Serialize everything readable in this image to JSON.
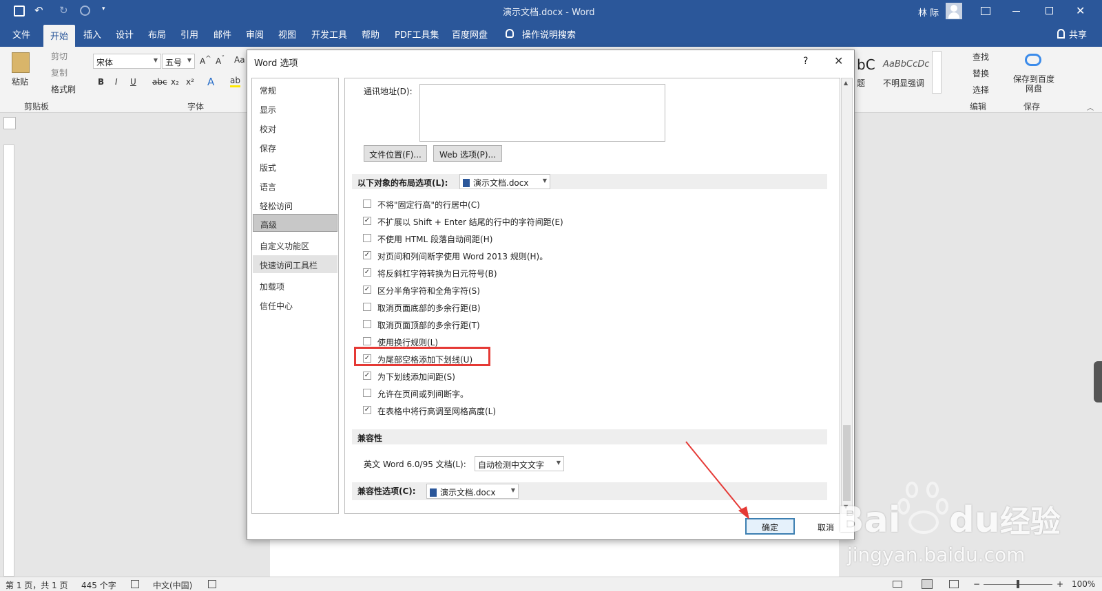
{
  "window": {
    "title": "演示文档.docx - Word",
    "user": "林 际"
  },
  "tabs": [
    "文件",
    "开始",
    "插入",
    "设计",
    "布局",
    "引用",
    "邮件",
    "审阅",
    "视图",
    "开发工具",
    "帮助",
    "PDF工具集",
    "百度网盘"
  ],
  "tell_me": "操作说明搜索",
  "share": "共享",
  "ribbon": {
    "paste": "粘贴",
    "cut": "剪切",
    "copy": "复制",
    "format_painter": "格式刷",
    "clipboard_group": "剪贴板",
    "font_name": "宋体",
    "font_size": "五号",
    "font_group": "字体",
    "styles_partial_1": "bC",
    "styles_partial_2": "AaBbCcDc",
    "styles_label_1": "题",
    "styles_label_2": "不明显强调",
    "find": "查找",
    "replace": "替换",
    "select": "选择",
    "editing_group": "编辑",
    "save_to_baidu": "保存到百度网盘",
    "save_group": "保存"
  },
  "dialog": {
    "title": "Word 选项",
    "help": "?",
    "nav": [
      "常规",
      "显示",
      "校对",
      "保存",
      "版式",
      "语言",
      "轻松访问",
      "高级",
      "自定义功能区",
      "快速访问工具栏",
      "加载项",
      "信任中心"
    ],
    "active_nav": "高级",
    "mailing_address_label": "通讯地址(D):",
    "file_locations_button": "文件位置(F)...",
    "web_options_button": "Web 选项(P)...",
    "layout_section_label": "以下对象的布局选项(L):",
    "layout_doc": "演示文档.docx",
    "options": [
      {
        "label": "不将\"固定行高\"的行居中(C)",
        "checked": false
      },
      {
        "label": "不扩展以 Shift + Enter 结尾的行中的字符间距(E)",
        "checked": true
      },
      {
        "label": "不使用 HTML 段落自动间距(H)",
        "checked": false
      },
      {
        "label": "对页间和列间断字使用 Word 2013 规则(H)。",
        "checked": true
      },
      {
        "label": "将反斜杠字符转换为日元符号(B)",
        "checked": true
      },
      {
        "label": "区分半角字符和全角字符(S)",
        "checked": true
      },
      {
        "label": "取消页面底部的多余行距(B)",
        "checked": false
      },
      {
        "label": "取消页面顶部的多余行距(T)",
        "checked": false
      },
      {
        "label": "使用换行规则(L)",
        "checked": false
      },
      {
        "label": "为尾部空格添加下划线(U)",
        "checked": true
      },
      {
        "label": "为下划线添加间距(S)",
        "checked": true
      },
      {
        "label": "允许在页间或列间断字。",
        "checked": false
      },
      {
        "label": "在表格中将行高调至网格高度(L)",
        "checked": true
      }
    ],
    "compat_section": "兼容性",
    "compat_word_label": "英文 Word 6.0/95 文档(L):",
    "compat_word_value": "自动检测中文文字",
    "compat_options_label": "兼容性选项(C):",
    "compat_options_doc": "演示文档.docx",
    "ok": "确定",
    "cancel": "取消"
  },
  "status": {
    "page": "第 1 页，共 1 页",
    "words": "445 个字",
    "language": "中文(中国)",
    "zoom": "100%"
  },
  "watermark": {
    "brand": "Bai",
    "brand2": "du",
    "cn": "经验",
    "url": "jingyan.baidu.com"
  },
  "colors": {
    "accent": "#2b579a",
    "highlight": "#e53935"
  }
}
